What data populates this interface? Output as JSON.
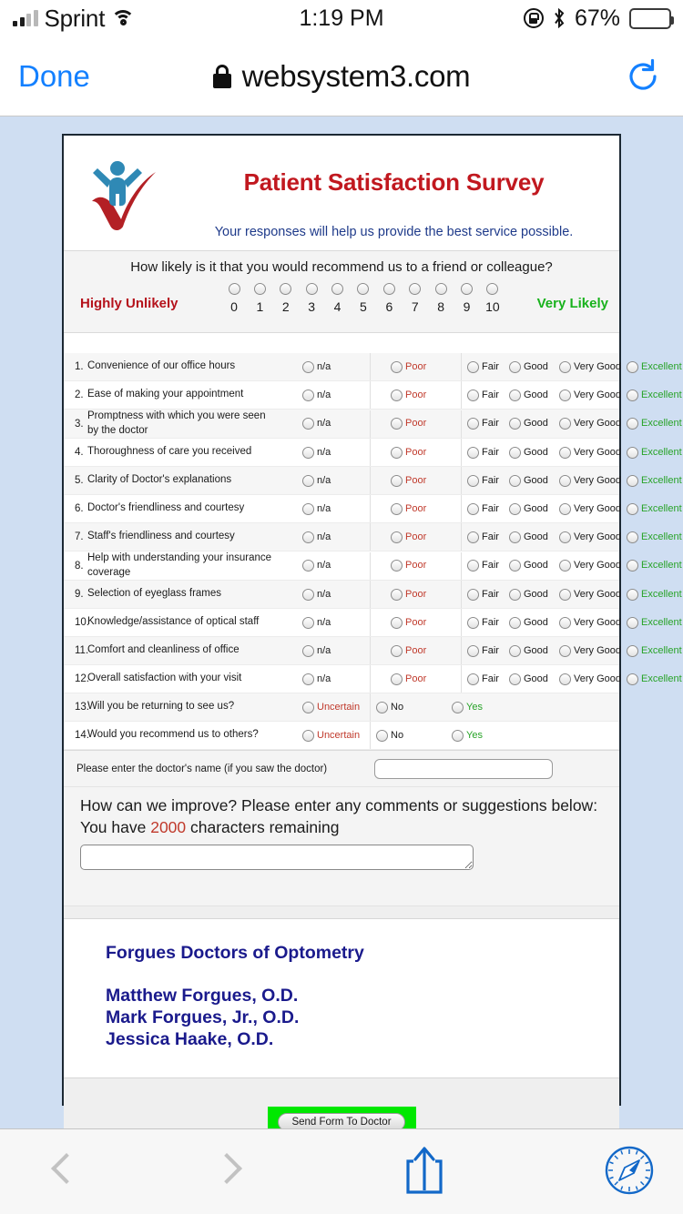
{
  "status_bar": {
    "carrier": "Sprint",
    "time": "1:19 PM",
    "battery_percent": "67%",
    "signal_icon": "signal-bars-icon",
    "wifi_icon": "wifi-icon",
    "rotation_lock_icon": "rotation-lock-icon",
    "bluetooth_icon": "bluetooth-icon",
    "battery_icon": "battery-icon"
  },
  "browser_bar": {
    "done_label": "Done",
    "url": "websystem3.com",
    "lock_icon": "lock-icon",
    "reload_icon": "reload-icon"
  },
  "survey": {
    "title": "Patient Satisfaction Survey",
    "subtitle": "Your responses will help us provide the best service possible.",
    "logo_icon": "person-checkmark-logo-icon",
    "nps": {
      "question": "How likely is it that you would recommend us to a friend or colleague?",
      "left_label": "Highly Unlikely",
      "right_label": "Very Likely",
      "scale": [
        "0",
        "1",
        "2",
        "3",
        "4",
        "5",
        "6",
        "7",
        "8",
        "9",
        "10"
      ]
    },
    "rating_options": [
      "n/a",
      "Poor",
      "Fair",
      "Good",
      "Very Good",
      "Excellent"
    ],
    "yesno_options": [
      "Uncertain",
      "No",
      "Yes"
    ],
    "questions": [
      {
        "num": "1.",
        "text": "Convenience of our office hours",
        "type": "rating"
      },
      {
        "num": "2.",
        "text": "Ease of making your appointment",
        "type": "rating"
      },
      {
        "num": "3.",
        "text": "Promptness with which you were seen by the doctor",
        "type": "rating"
      },
      {
        "num": "4.",
        "text": "Thoroughness of care you received",
        "type": "rating"
      },
      {
        "num": "5.",
        "text": "Clarity of Doctor's explanations",
        "type": "rating"
      },
      {
        "num": "6.",
        "text": "Doctor's friendliness and courtesy",
        "type": "rating"
      },
      {
        "num": "7.",
        "text": "Staff's friendliness and courtesy",
        "type": "rating"
      },
      {
        "num": "8.",
        "text": "Help with understanding your insurance coverage",
        "type": "rating"
      },
      {
        "num": "9.",
        "text": "Selection of eyeglass frames",
        "type": "rating"
      },
      {
        "num": "10.",
        "text": "Knowledge/assistance of optical staff",
        "type": "rating"
      },
      {
        "num": "11.",
        "text": "Comfort and cleanliness of office",
        "type": "rating"
      },
      {
        "num": "12.",
        "text": "Overall satisfaction with your visit",
        "type": "rating"
      },
      {
        "num": "13.",
        "text": "Will you be returning to see us?",
        "type": "yesno"
      },
      {
        "num": "14.",
        "text": "Would you recommend us to others?",
        "type": "yesno"
      }
    ],
    "doctor_name": {
      "label": "Please enter the doctor's name (if you saw the doctor)",
      "value": ""
    },
    "improve": {
      "line1": "How can we improve? Please enter any comments or suggestions below:",
      "prefix": "You have ",
      "count": "2000",
      "suffix": " characters remaining",
      "comment_value": ""
    },
    "practice": {
      "name": "Forgues Doctors of Optometry",
      "doctors": [
        "Matthew Forgues, O.D.",
        "Mark Forgues, Jr., O.D.",
        "Jessica Haake, O.D."
      ]
    },
    "submit_label": "Send Form To Doctor"
  },
  "toolbar": {
    "back_icon": "chevron-left-icon",
    "forward_icon": "chevron-right-icon",
    "share_icon": "share-icon",
    "bookmarks_icon": "safari-compass-icon"
  },
  "colors": {
    "title_red": "#c1181f",
    "accent_blue": "#1380ff",
    "green": "#27a327",
    "submit_green": "#00e800",
    "page_bg": "#cfdef2"
  }
}
